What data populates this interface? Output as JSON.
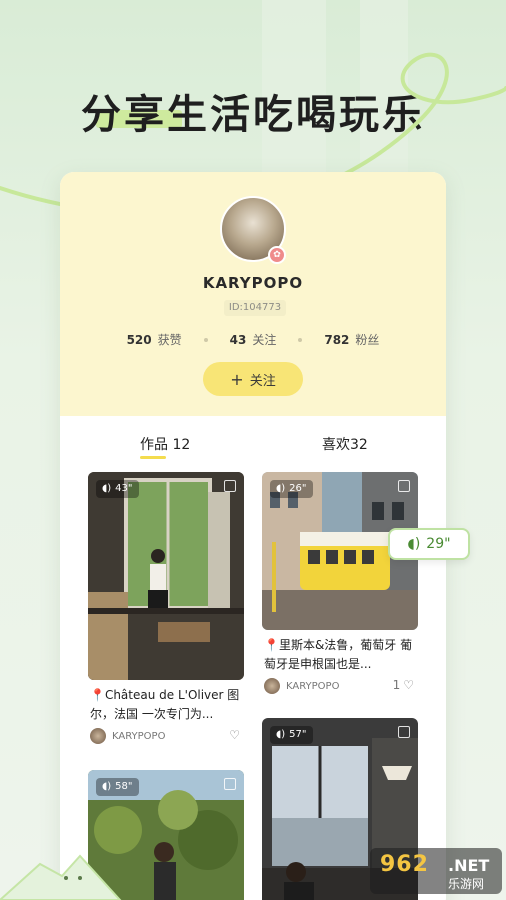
{
  "headline": "分享生活吃喝玩乐",
  "profile": {
    "username": "KARYPOPO",
    "user_id": "ID:104773",
    "stats": [
      {
        "value": "520",
        "label": "获赞"
      },
      {
        "value": "43",
        "label": "关注"
      },
      {
        "value": "782",
        "label": "粉丝"
      }
    ],
    "follow_plus": "+",
    "follow_label": "关注"
  },
  "tabs": {
    "works_label": "作品",
    "works_count": "12",
    "likes_label": "喜欢",
    "likes_count": "32"
  },
  "posts": [
    {
      "duration": "43\"",
      "title": "📍Château de L'Oliver 图尔，法国  一次专门为...",
      "user": "KARYPOPO",
      "likes": ""
    },
    {
      "duration": "26\"",
      "title": "📍里斯本&法鲁，葡萄牙 葡萄牙是申根国也是...",
      "user": "KARYPOPO",
      "likes": "1"
    },
    {
      "duration": "58\"",
      "title": "",
      "user": "",
      "likes": ""
    },
    {
      "duration": "57\"",
      "title": "",
      "user": "",
      "likes": ""
    }
  ],
  "tooltip": {
    "duration": "29\""
  },
  "watermark": {
    "num": "962",
    "net": ".NET",
    "cn": "乐游网"
  },
  "colors": {
    "accent_yellow": "#f8e576",
    "profile_bg": "#fcf6cf",
    "bg_green": "#d9ecd6",
    "swirl_green": "#c7e89a"
  },
  "icons": {
    "sound": "sound-wave-icon",
    "heart": "heart-icon",
    "badge": "verified-badge-icon",
    "corner": "select-square-icon"
  }
}
